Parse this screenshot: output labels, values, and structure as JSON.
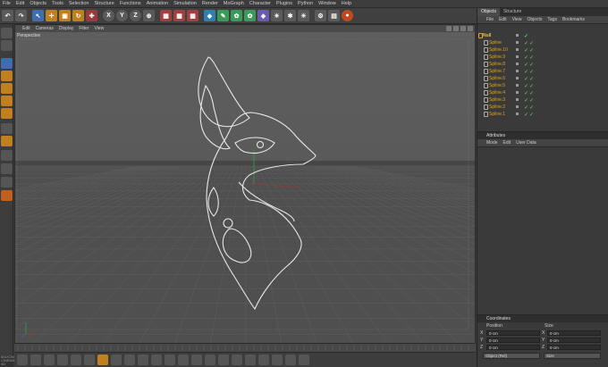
{
  "menubar": {
    "items": [
      "File",
      "Edit",
      "Objects",
      "Tools",
      "Selection",
      "Structure",
      "Functions",
      "Animation",
      "Simulation",
      "Render",
      "MoGraph",
      "Character",
      "Plugins",
      "Python",
      "Window",
      "Help"
    ]
  },
  "viewport": {
    "menu": [
      "Edit",
      "Cameras",
      "Display",
      "Filter",
      "View"
    ],
    "label": "Perspective"
  },
  "object_manager": {
    "tabs": [
      "Objects",
      "Structure"
    ],
    "menu": [
      "File",
      "Edit",
      "View",
      "Objects",
      "Tags",
      "Bookmarks"
    ],
    "items": [
      {
        "name": "Null",
        "type": "null"
      },
      {
        "name": "Spline",
        "type": "spline"
      },
      {
        "name": "Spline.10",
        "type": "spline"
      },
      {
        "name": "Spline.9",
        "type": "spline"
      },
      {
        "name": "Spline.8",
        "type": "spline"
      },
      {
        "name": "Spline.7",
        "type": "spline"
      },
      {
        "name": "Spline.6",
        "type": "spline"
      },
      {
        "name": "Spline.5",
        "type": "spline"
      },
      {
        "name": "Spline.4",
        "type": "spline"
      },
      {
        "name": "Spline.3",
        "type": "spline"
      },
      {
        "name": "Spline.2",
        "type": "spline"
      },
      {
        "name": "Spline.1",
        "type": "spline"
      }
    ]
  },
  "attributes": {
    "title": "Attributes",
    "menu": [
      "Mode",
      "Edit",
      "User Data"
    ]
  },
  "coordinates": {
    "title": "Coordinates",
    "col_position": "Position",
    "col_size": "Size",
    "rows": [
      {
        "axis": "X",
        "pos": "0 cm",
        "size": "0 cm"
      },
      {
        "axis": "Y",
        "pos": "0 cm",
        "size": "0 cm"
      },
      {
        "axis": "Z",
        "pos": "0 cm",
        "size": "0 cm"
      }
    ],
    "mode_select": "Object (Rel)",
    "size_select": "Size"
  },
  "corner_logo": "MAXON CINEMA 4D",
  "colors": {
    "accent_orange": "#e6a020",
    "viewport_bg": "#5c5c5c",
    "check_green": "#66cc66"
  }
}
